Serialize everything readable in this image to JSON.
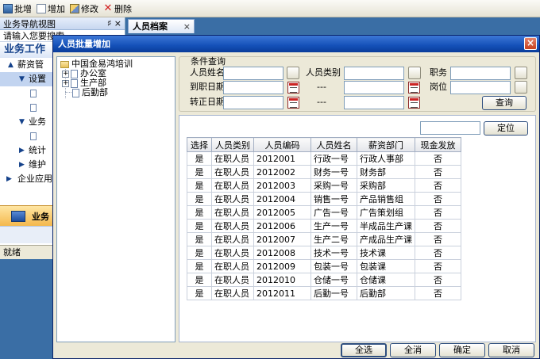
{
  "toolbar": {
    "batch_label": "批增",
    "add_label": "增加",
    "edit_label": "修改",
    "delete_label": "删除"
  },
  "nav": {
    "header": "业务导航视图",
    "pin": "♯",
    "close": "×",
    "search_placeholder": "请输入您要搜索",
    "title": "业务工作",
    "items": [
      {
        "label": "薪资管",
        "level": 1
      },
      {
        "label": "设置",
        "level": 2
      },
      {
        "label": "",
        "level": 3
      },
      {
        "label": "",
        "level": 3
      },
      {
        "label": "业务",
        "level": 2
      },
      {
        "label": "",
        "level": 3
      },
      {
        "label": "统计",
        "level": 2
      },
      {
        "label": "维护",
        "level": 2
      },
      {
        "label": "企业应用集",
        "level": 1
      }
    ],
    "bottom_label": "业务",
    "status": "就绪"
  },
  "doc_tab": {
    "label": "人员档案",
    "close": "×"
  },
  "dialog": {
    "title": "人员批量增加",
    "close": "×",
    "tree": {
      "root": "中国金易鸿培训",
      "children": [
        "办公室",
        "生产部",
        "后勤部"
      ]
    },
    "filter": {
      "legend": "条件查询",
      "name_label": "人员姓名",
      "category_label": "人员类别",
      "position_label": "职务",
      "hire_date_label": "到职日期",
      "post_label": "岗位",
      "regular_date_label": "转正日期",
      "range_sep": "---",
      "query_button": "查询"
    },
    "locate_button": "定位",
    "table": {
      "headers": [
        "选择",
        "人员类别",
        "人员编码",
        "人员姓名",
        "薪资部门",
        "现金发放"
      ],
      "rows": [
        [
          "是",
          "在职人员",
          "2012001",
          "行政一号",
          "行政人事部",
          "否"
        ],
        [
          "是",
          "在职人员",
          "2012002",
          "财务一号",
          "财务部",
          "否"
        ],
        [
          "是",
          "在职人员",
          "2012003",
          "采购一号",
          "采购部",
          "否"
        ],
        [
          "是",
          "在职人员",
          "2012004",
          "销售一号",
          "产品销售组",
          "否"
        ],
        [
          "是",
          "在职人员",
          "2012005",
          "广告一号",
          "广告策划组",
          "否"
        ],
        [
          "是",
          "在职人员",
          "2012006",
          "生产一号",
          "半成品生产课",
          "否"
        ],
        [
          "是",
          "在职人员",
          "2012007",
          "生产二号",
          "产成品生产课",
          "否"
        ],
        [
          "是",
          "在职人员",
          "2012008",
          "技术一号",
          "技术课",
          "否"
        ],
        [
          "是",
          "在职人员",
          "2012009",
          "包装一号",
          "包装课",
          "否"
        ],
        [
          "是",
          "在职人员",
          "2012010",
          "仓储一号",
          "仓储课",
          "否"
        ],
        [
          "是",
          "在职人员",
          "2012011",
          "后勤一号",
          "后勤部",
          "否"
        ]
      ]
    },
    "buttons": {
      "select_all": "全选",
      "deselect_all": "全消",
      "ok": "确定",
      "cancel": "取消"
    }
  },
  "colors": {
    "titlebar": "#1450b8",
    "desktop": "#3a6ea5",
    "dialog_bg": "#ece9d8"
  }
}
